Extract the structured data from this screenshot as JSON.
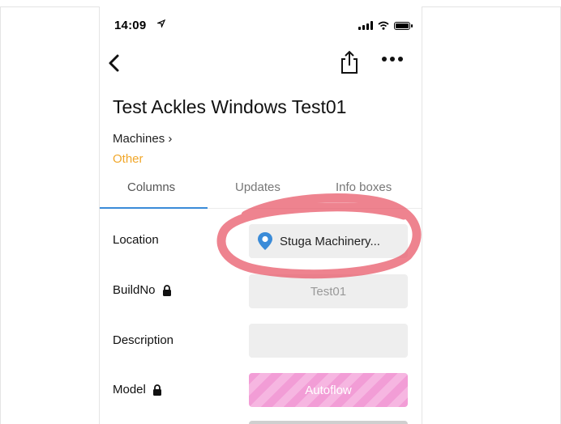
{
  "status_bar": {
    "time": "14:09"
  },
  "record": {
    "title": "Test Ackles Windows Test01",
    "breadcrumb": "Machines ›",
    "category": "Other"
  },
  "tabs": [
    {
      "label": "Columns",
      "active": true
    },
    {
      "label": "Updates",
      "active": false
    },
    {
      "label": "Info boxes",
      "active": false
    }
  ],
  "fields": {
    "location": {
      "label": "Location",
      "value": "Stuga Machinery..."
    },
    "buildno": {
      "label": "BuildNo",
      "value": "Test01",
      "locked": true
    },
    "description": {
      "label": "Description",
      "value": ""
    },
    "model": {
      "label": "Model",
      "value": "Autoflow",
      "locked": true
    }
  },
  "icons": {
    "back": "chevron-left-icon",
    "share": "share-icon",
    "more": "more-dots-icon",
    "location": "map-pin-icon",
    "lock": "lock-icon"
  },
  "colors": {
    "accent_blue": "#3a8bd8",
    "category_orange": "#f1a72a",
    "model_pink": "#f29dd6",
    "annotation_red": "#e85a6a"
  }
}
